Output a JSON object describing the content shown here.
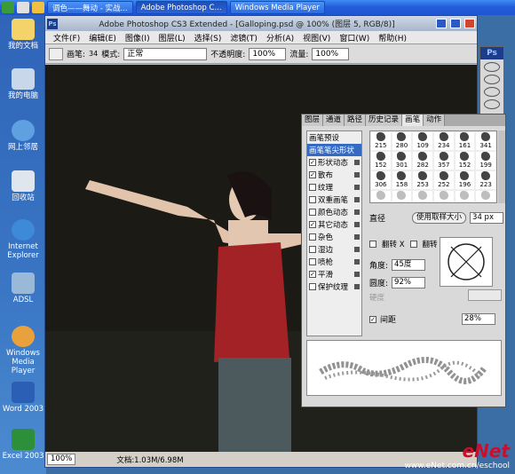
{
  "taskbar": {
    "items": [
      {
        "label": "调色——舞动 - 实战..."
      },
      {
        "label": "Adobe Photoshop C..."
      },
      {
        "label": "Windows Media Player"
      }
    ]
  },
  "desktop": {
    "icons": [
      "我的文档",
      "我的电脑",
      "网上邻居",
      "回收站",
      "Internet Explorer",
      "ADSL",
      "Windows Media Player",
      "Word 2003",
      "Excel 2003"
    ]
  },
  "app": {
    "title": "Adobe Photoshop CS3 Extended - [Galloping.psd @ 100% (图层 5, RGB/8)]",
    "logo": "Ps",
    "menu": [
      "文件(F)",
      "编辑(E)",
      "图像(I)",
      "图层(L)",
      "选择(S)",
      "滤镜(T)",
      "分析(A)",
      "视图(V)",
      "窗口(W)",
      "帮助(H)"
    ],
    "options": {
      "brush_label": "画笔:",
      "brush_size": "34",
      "mode_label": "模式:",
      "mode_value": "正常",
      "opacity_label": "不透明度:",
      "opacity_value": "100%",
      "flow_label": "流量:",
      "flow_value": "100%"
    },
    "status": {
      "zoom": "100%",
      "doc": "文档:1.03M/6.98M"
    }
  },
  "brush_panel": {
    "tabs": [
      "图层",
      "通道",
      "路径",
      "历史记录",
      "画笔",
      "动作"
    ],
    "preset_header": "画笔预设",
    "presets": [
      {
        "label": "画笔笔尖形状",
        "checked": false,
        "selected": true
      },
      {
        "label": "形状动态",
        "checked": true,
        "selected": false
      },
      {
        "label": "散布",
        "checked": true,
        "selected": false
      },
      {
        "label": "纹理",
        "checked": false,
        "selected": false
      },
      {
        "label": "双重画笔",
        "checked": false,
        "selected": false
      },
      {
        "label": "颜色动态",
        "checked": false,
        "selected": false
      },
      {
        "label": "其它动态",
        "checked": true,
        "selected": false
      },
      {
        "label": "杂色",
        "checked": false,
        "selected": false
      },
      {
        "label": "湿边",
        "checked": false,
        "selected": false
      },
      {
        "label": "喷枪",
        "checked": false,
        "selected": false
      },
      {
        "label": "平滑",
        "checked": true,
        "selected": false
      },
      {
        "label": "保护纹理",
        "checked": false,
        "selected": false
      }
    ],
    "tips": [
      "215",
      "280",
      "109",
      "234",
      "161",
      "341",
      "152",
      "301",
      "282",
      "357",
      "152",
      "199",
      "306",
      "158",
      "253",
      "252",
      "196",
      "223",
      "",
      "",
      "",
      "",
      "",
      ""
    ],
    "diameter_label": "直径",
    "sample_button": "使用取样大小",
    "diameter_value": "34 px",
    "flip_x": "翻转 X",
    "flip_y": "翻转 Y",
    "angle_label": "角度:",
    "angle_value": "45度",
    "round_label": "圆度:",
    "round_value": "92%",
    "hardness_label": "硬度",
    "spacing_label": "间距",
    "spacing_value": "28%"
  },
  "watermark": {
    "logo": "eNet",
    "url": "www.eNet.com.cn/eschool"
  }
}
